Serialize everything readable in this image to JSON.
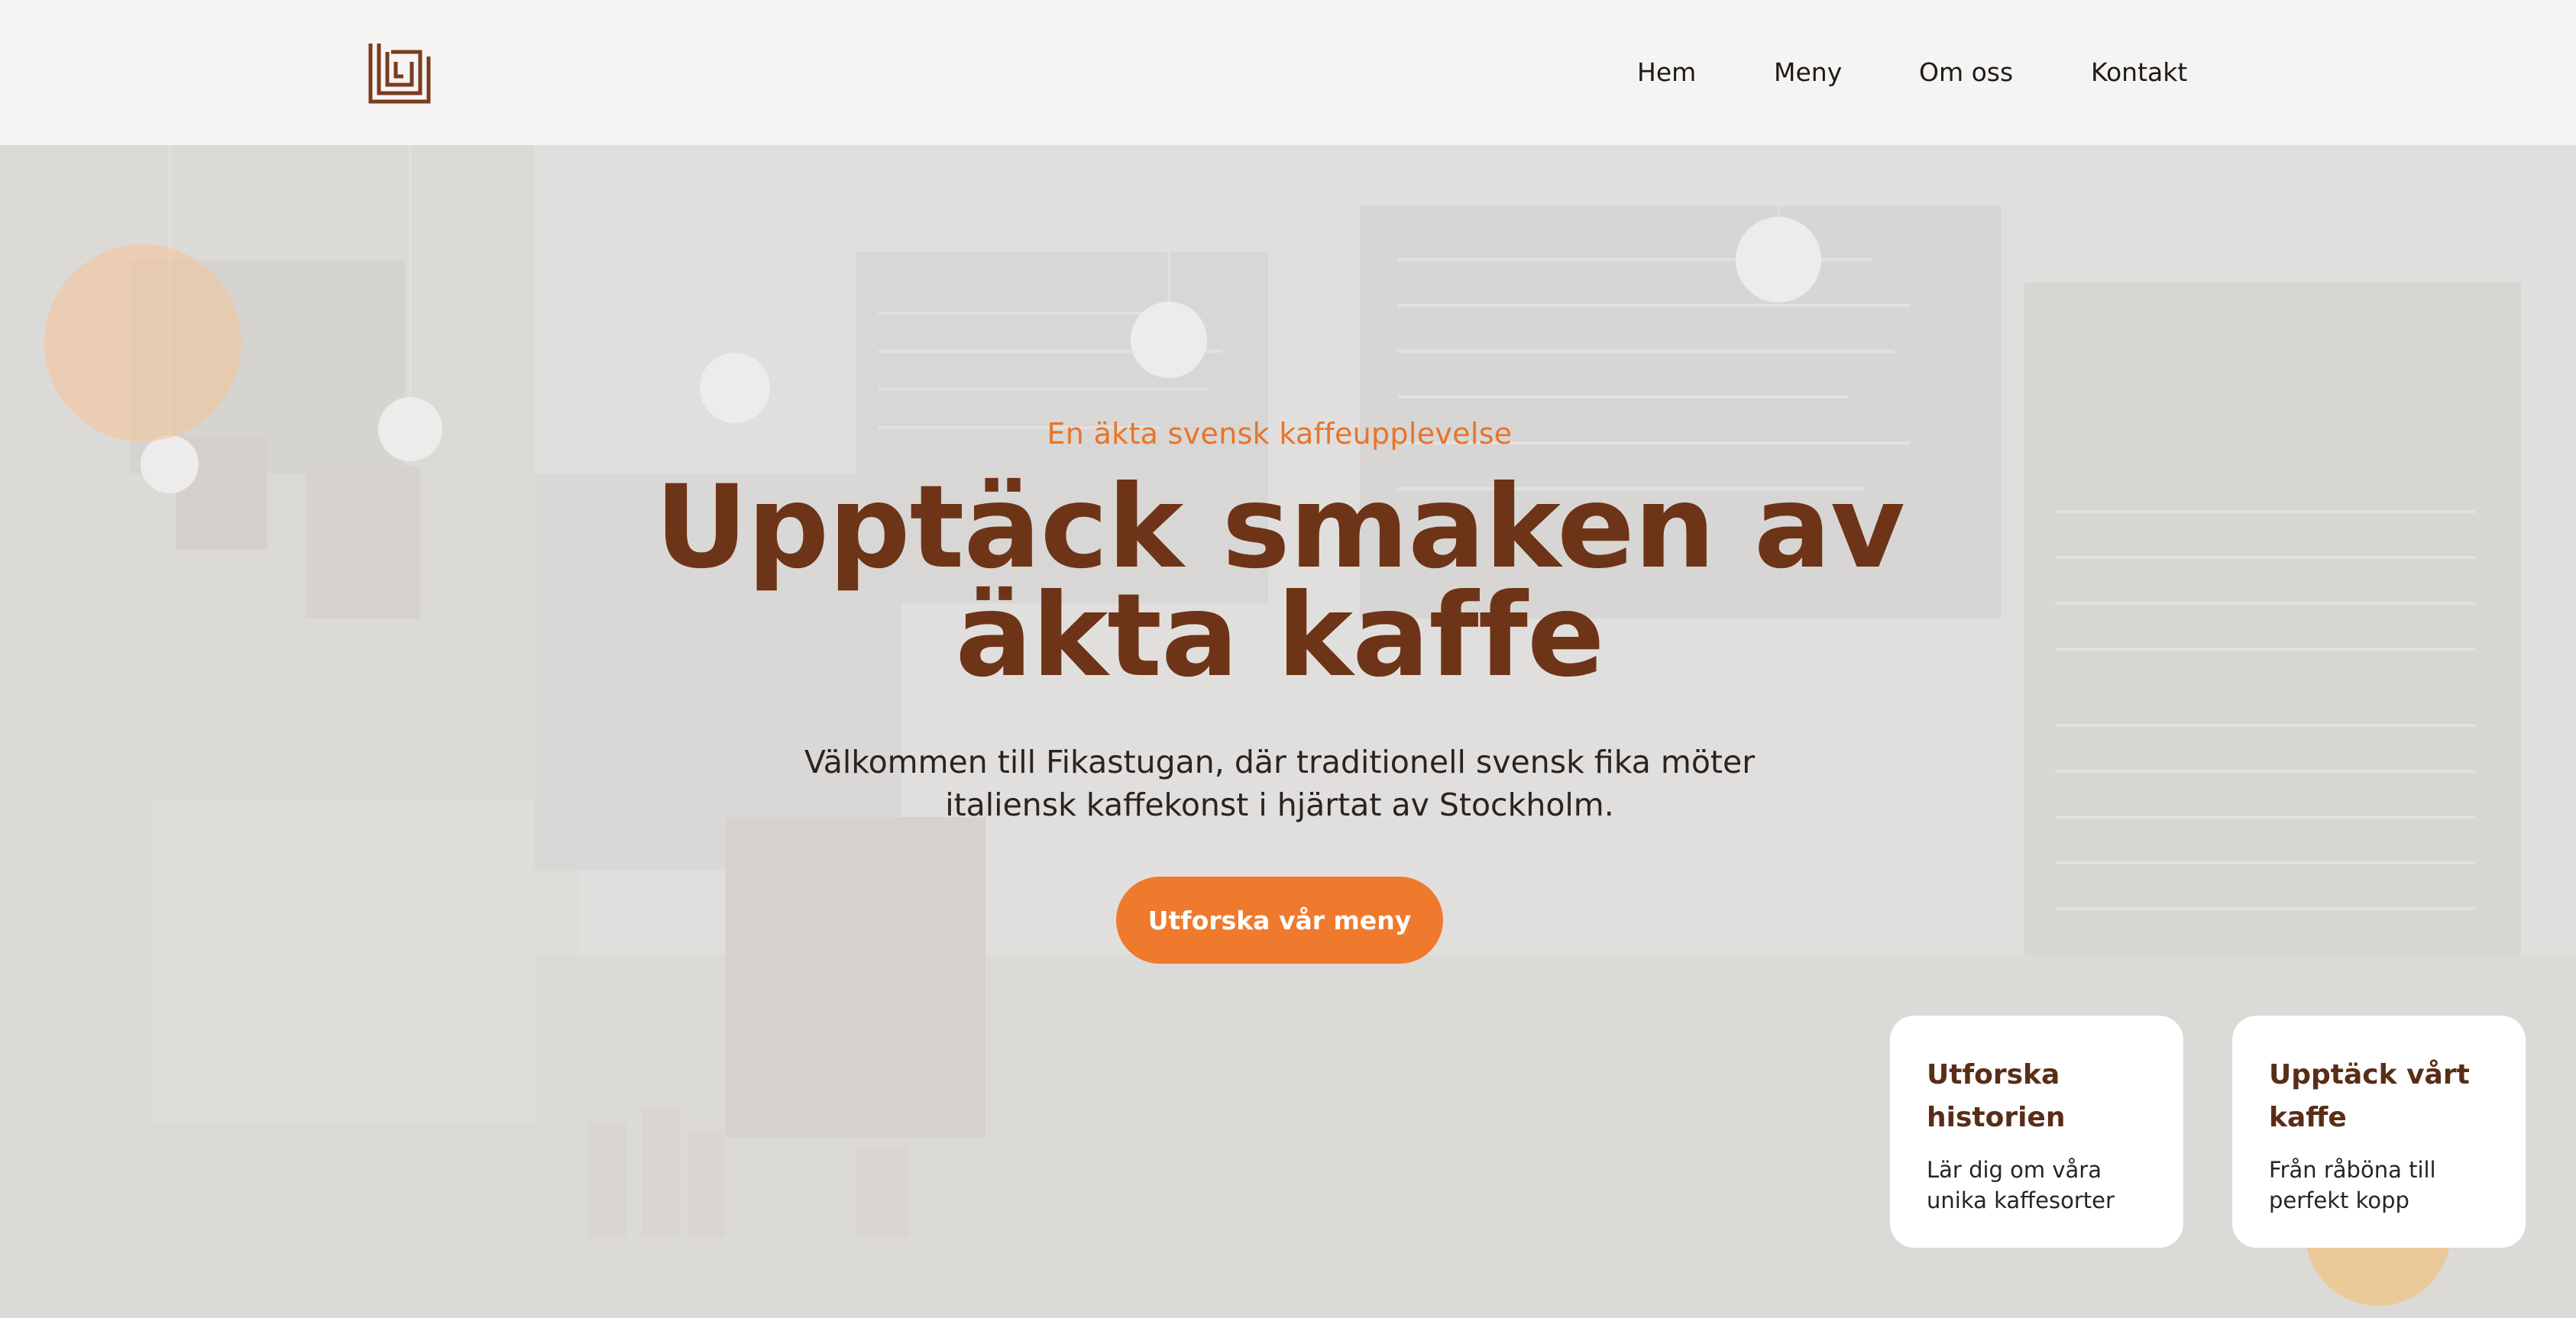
{
  "header": {
    "logo_icon": "square-spiral-logo-icon",
    "nav": [
      {
        "label": "Hem"
      },
      {
        "label": "Meny"
      },
      {
        "label": "Om oss"
      },
      {
        "label": "Kontakt"
      }
    ]
  },
  "hero": {
    "eyebrow": "En äkta svensk kaffeupplevelse",
    "headline_line1": "Upptäck smaken av",
    "headline_line2": "äkta kaffe",
    "subtitle_line1": "Välkommen till Fikastugan, där traditionell svensk fika möter",
    "subtitle_line2": "italiensk kaffekonst i hjärtat av Stockholm.",
    "cta_label": "Utforska vår meny"
  },
  "cards": [
    {
      "title_line1": "Utforska",
      "title_line2": "historien",
      "text_line1": "Lär dig om våra",
      "text_line2": "unika kaffesorter"
    },
    {
      "title_line1": "Upptäck vårt",
      "title_line2": "kaffe",
      "text_line1": "Från råböna till",
      "text_line2": "perfekt kopp"
    }
  ],
  "colors": {
    "accent": "#ef7a2e",
    "headline": "#6e3417",
    "logo": "#7a3c1e",
    "card_title": "#5a2d17"
  }
}
